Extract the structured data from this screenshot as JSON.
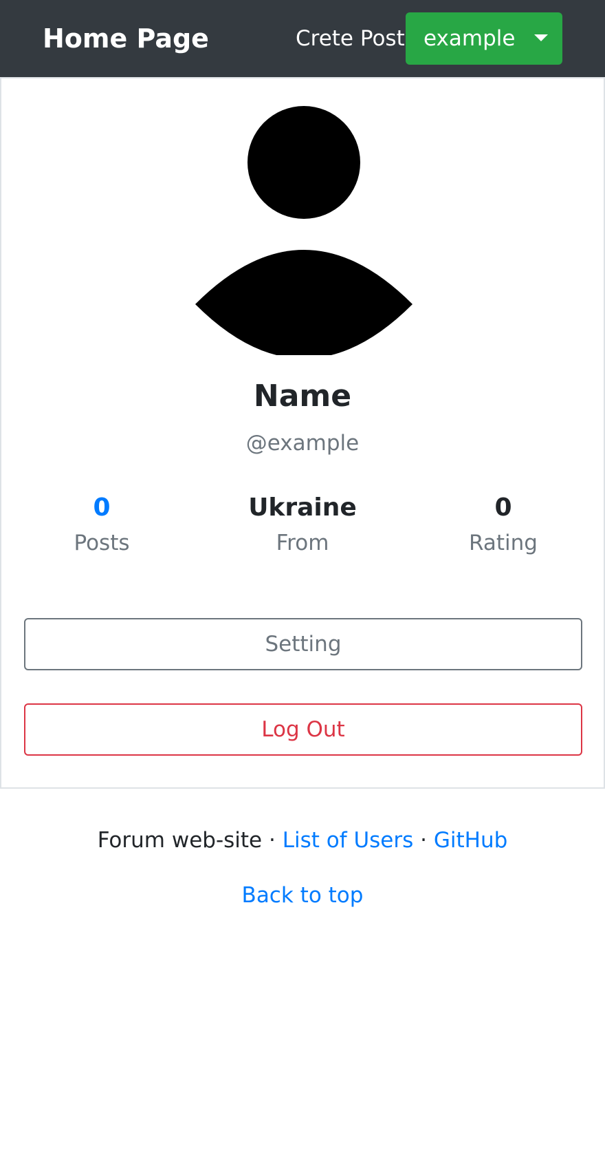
{
  "navbar": {
    "brand": "Home Page",
    "create_post": "Crete Post",
    "user_menu_label": "example"
  },
  "profile": {
    "avatar_icon": "user-silhouette-icon",
    "name": "Name",
    "handle": "@example",
    "stats": [
      {
        "value": "0",
        "label": "Posts"
      },
      {
        "value": "Ukraine",
        "label": "From"
      },
      {
        "value": "0",
        "label": "Rating"
      }
    ],
    "setting_button": "Setting",
    "logout_button": "Log Out"
  },
  "footer": {
    "site_text": "Forum web-site",
    "separator": " · ",
    "users_link": "List of Users",
    "github_link": "GitHub",
    "back_to_top": "Back to top"
  },
  "colors": {
    "navbar_bg": "#343a40",
    "success": "#28a745",
    "link": "#007bff",
    "danger": "#dc3545",
    "muted": "#6c757d"
  }
}
